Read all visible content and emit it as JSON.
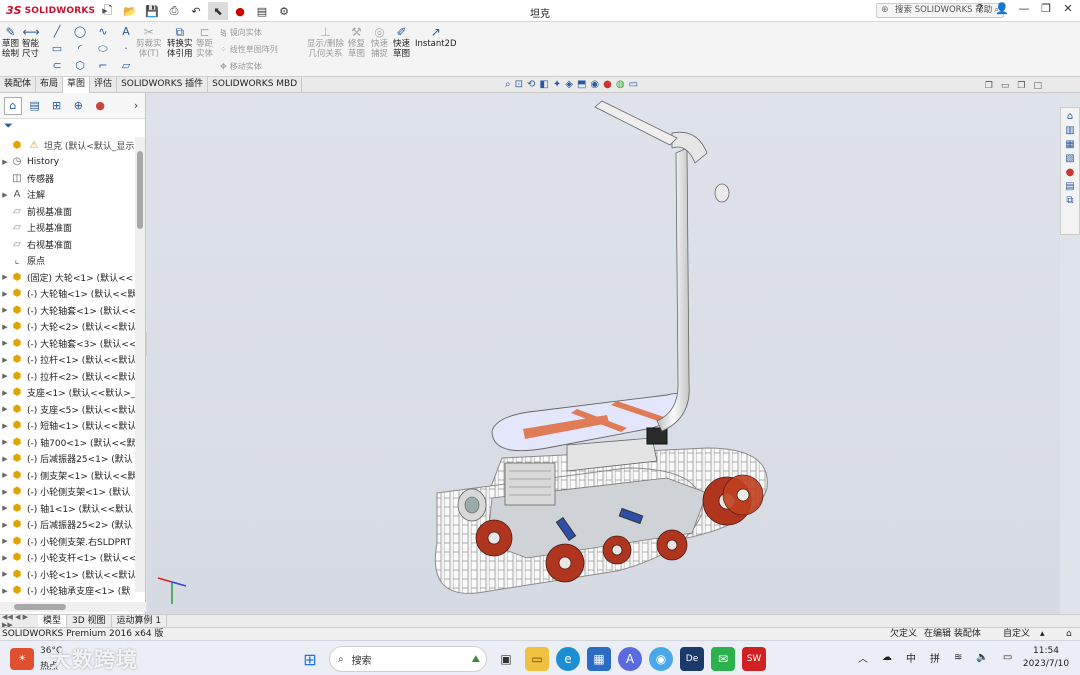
{
  "app": {
    "brand_ds": "3S",
    "brand_name": "SOLIDWORKS",
    "document_title": "坦克"
  },
  "help_search": {
    "placeholder": "搜索 SOLIDWORKS 帮助"
  },
  "commands": {
    "sketch": "草图\n绘制",
    "smart_dim": "智能\n尺寸",
    "trim": "剪裁实\n体(T)",
    "convert": "转换实\n体引用",
    "offset": "等距\n实体",
    "mirror": "镜向实体",
    "linear_pattern": "线性草图阵列",
    "move": "移动实体",
    "show_hide": "显示/删除\n几何关系",
    "repair": "修复\n草图",
    "quick_snap": "快速\n捕捉",
    "rapid_sketch": "快速\n草图",
    "instant2d": "Instant2D"
  },
  "ribbon_tabs": [
    "装配体",
    "布局",
    "草图",
    "评估",
    "SOLIDWORKS 插件",
    "SOLIDWORKS MBD"
  ],
  "active_ribbon_tab": "草图",
  "tree": {
    "root": "坦克 (默认<默认_显示",
    "history": "History",
    "sensors": "传感器",
    "annotations": "注解",
    "front_plane": "前视基准面",
    "top_plane": "上视基准面",
    "right_plane": "右视基准面",
    "origin": "原点",
    "components": [
      "(固定) 大轮<1> (默认<<",
      "(-) 大轮轴<1> (默认<<默",
      "(-) 大轮轴套<1> (默认<<",
      "(-) 大轮<2> (默认<<默认",
      "(-) 大轮轴套<3> (默认<<",
      "(-) 拉杆<1> (默认<<默认",
      "(-) 拉杆<2> (默认<<默认",
      "支座<1> (默认<<默认>_",
      "(-) 支座<5> (默认<<默认",
      "(-) 短轴<1> (默认<<默认",
      "(-) 轴700<1> (默认<<默",
      "(-) 后减振器25<1> (默认",
      "(-) 侧支架<1> (默认<<默",
      "(-) 小轮侧支架<1> (默认",
      "(-) 轴1<1> (默认<<默认",
      "(-) 后减振器25<2> (默认",
      "(-) 小轮侧支架.右SLDPRT",
      "(-) 小轮支杆<1> (默认<<",
      "(-) 小轮<1> (默认<<默认",
      "(-) 小轮轴承支座<1> (默"
    ]
  },
  "bottom_tabs": [
    "模型",
    "3D 视图",
    "运动算例 1"
  ],
  "status": {
    "product": "SOLIDWORKS Premium 2016 x64 版",
    "under_defined": "欠定义",
    "editing": "在编辑 装配体",
    "custom": "自定义"
  },
  "taskbar": {
    "weather_temp": "36°C",
    "weather_desc": "热点",
    "watermark": "大数跨境",
    "search": "搜索",
    "ime_lang": "中",
    "ime_mode": "拼",
    "time": "11:54",
    "date": "2023/7/10"
  }
}
